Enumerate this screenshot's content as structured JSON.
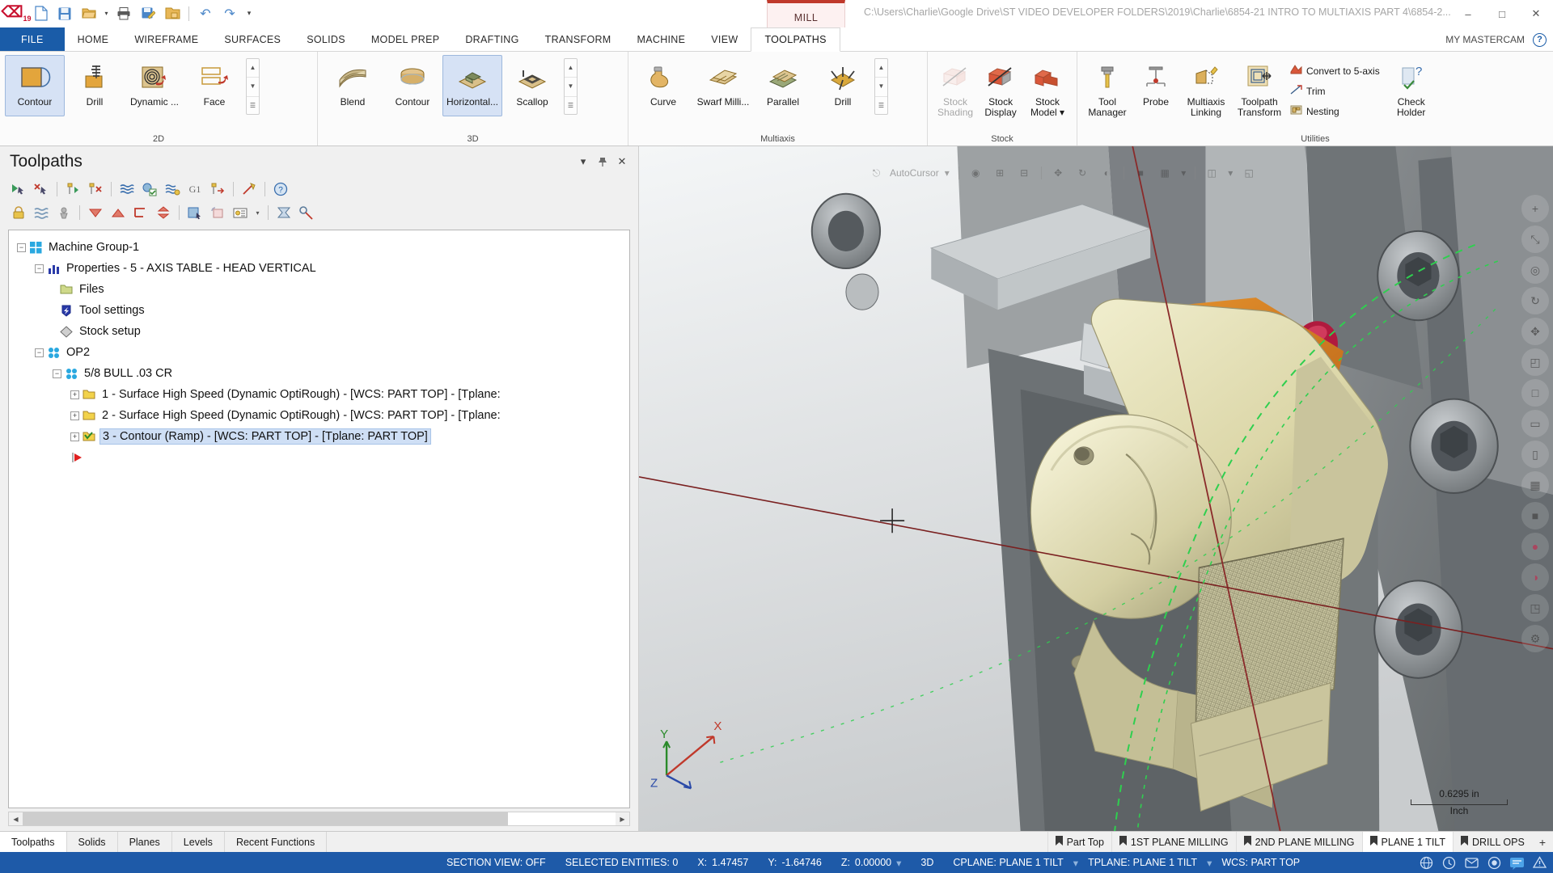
{
  "titlebar": {
    "logo": "mastercam-logo",
    "quick_access": [
      {
        "name": "new-file",
        "glyph": "🗋"
      },
      {
        "name": "save-file",
        "glyph": "💾"
      },
      {
        "name": "open-file",
        "glyph": "📂"
      },
      {
        "name": "print",
        "glyph": "🖨"
      },
      {
        "name": "save-as",
        "glyph": "📝"
      },
      {
        "name": "open-folder",
        "glyph": "📁"
      },
      {
        "name": "undo",
        "glyph": "↶"
      },
      {
        "name": "redo",
        "glyph": "↷"
      },
      {
        "name": "customize-qat",
        "glyph": "▾"
      }
    ],
    "machine_tab": "MILL",
    "file_path": "C:\\Users\\Charlie\\Google Drive\\ST VIDEO DEVELOPER FOLDERS\\2019\\Charlie\\6854-21 INTRO TO MULTIAXIS PART 4\\6854-2...",
    "window_controls": [
      {
        "name": "minimize-button",
        "glyph": "–"
      },
      {
        "name": "maximize-button",
        "glyph": "□"
      },
      {
        "name": "close-button",
        "glyph": "✕"
      }
    ]
  },
  "ribbon": {
    "tabs": [
      {
        "label": "FILE",
        "state": "file"
      },
      {
        "label": "HOME",
        "state": ""
      },
      {
        "label": "WIREFRAME",
        "state": ""
      },
      {
        "label": "SURFACES",
        "state": ""
      },
      {
        "label": "SOLIDS",
        "state": ""
      },
      {
        "label": "MODEL PREP",
        "state": ""
      },
      {
        "label": "DRAFTING",
        "state": ""
      },
      {
        "label": "TRANSFORM",
        "state": ""
      },
      {
        "label": "MACHINE",
        "state": ""
      },
      {
        "label": "VIEW",
        "state": ""
      },
      {
        "label": "TOOLPATHS",
        "state": "active"
      }
    ],
    "account_label": "MY MASTERCAM",
    "help_label": "?",
    "groups": [
      {
        "name": "2d",
        "label": "2D",
        "buttons": [
          {
            "label": "Contour",
            "icon": "contour-2d-icon",
            "state": "sel"
          },
          {
            "label": "Drill",
            "icon": "drill-2d-icon",
            "state": ""
          },
          {
            "label": "Dynamic ...",
            "icon": "dynamic-mill-icon",
            "state": ""
          },
          {
            "label": "Face",
            "icon": "face-icon",
            "state": ""
          }
        ],
        "has_gallery_nav": true
      },
      {
        "name": "3d",
        "label": "3D",
        "buttons": [
          {
            "label": "Blend",
            "icon": "blend-icon",
            "state": ""
          },
          {
            "label": "Contour",
            "icon": "contour-3d-icon",
            "state": ""
          },
          {
            "label": "Horizontal...",
            "icon": "horizontal-area-icon",
            "state": "sel"
          },
          {
            "label": "Scallop",
            "icon": "scallop-icon",
            "state": ""
          }
        ],
        "has_gallery_nav": true
      },
      {
        "name": "multiaxis",
        "label": "Multiaxis",
        "buttons": [
          {
            "label": "Curve",
            "icon": "curve-icon",
            "state": ""
          },
          {
            "label": "Swarf Milli...",
            "icon": "swarf-milling-icon",
            "state": ""
          },
          {
            "label": "Parallel",
            "icon": "parallel-icon",
            "state": ""
          },
          {
            "label": "Drill",
            "icon": "multiaxis-drill-icon",
            "state": ""
          }
        ],
        "has_gallery_nav": true
      },
      {
        "name": "stock",
        "label": "Stock",
        "buttons": [
          {
            "label": "Stock Shading",
            "icon": "stock-shading-icon",
            "state": "disabled"
          },
          {
            "label": "Stock Display",
            "icon": "stock-display-icon",
            "state": ""
          },
          {
            "label": "Stock Model ▾",
            "icon": "stock-model-icon",
            "state": ""
          }
        ],
        "has_gallery_nav": false
      },
      {
        "name": "utilities",
        "label": "Utilities",
        "buttons": [
          {
            "label": "Tool Manager",
            "icon": "tool-manager-icon",
            "state": ""
          },
          {
            "label": "Probe",
            "icon": "probe-icon",
            "state": ""
          },
          {
            "label": "Multiaxis Linking",
            "icon": "multiaxis-linking-icon",
            "state": ""
          },
          {
            "label": "Toolpath Transform",
            "icon": "toolpath-transform-icon",
            "state": ""
          }
        ],
        "small_buttons": [
          {
            "label": "Convert to 5-axis",
            "icon": "convert-5axis-icon"
          },
          {
            "label": "Trim",
            "icon": "trim-icon"
          },
          {
            "label": "Nesting",
            "icon": "nesting-icon"
          }
        ],
        "tall_buttons": [
          {
            "label": "Check Holder",
            "icon": "check-holder-icon"
          }
        ],
        "has_gallery_nav": false
      }
    ]
  },
  "toolpaths_panel": {
    "title": "Toolpaths",
    "header_buttons": [
      {
        "name": "panel-dropdown-button",
        "glyph": "▾"
      },
      {
        "name": "panel-pin-button",
        "glyph": "📌"
      },
      {
        "name": "panel-close-button",
        "glyph": "✕"
      }
    ],
    "toolbar_row1": [
      {
        "name": "select-all-operations-icon",
        "glyph": "▶"
      },
      {
        "name": "select-all-invalid-icon",
        "glyph": "✖"
      },
      {
        "name": "regenerate-all-selected-icon",
        "glyph": "↑"
      },
      {
        "name": "regenerate-all-dirty-icon",
        "glyph": "✗"
      },
      {
        "name": "simulate-toolpath-icon",
        "glyph": "≋"
      },
      {
        "name": "verify-toolpath-icon",
        "glyph": "◑"
      },
      {
        "name": "simulate-selected-icon",
        "glyph": "≈"
      },
      {
        "name": "g1-post-icon",
        "glyph": "G1"
      },
      {
        "name": "high-speed-icon",
        "glyph": "↦"
      },
      {
        "name": "edit-toolpath-icon",
        "glyph": "✇"
      },
      {
        "name": "help-icon",
        "glyph": "?"
      }
    ],
    "toolbar_row2": [
      {
        "name": "lock-selected-icon",
        "glyph": "🔒"
      },
      {
        "name": "toggle-posting-icon",
        "glyph": "≋"
      },
      {
        "name": "toggle-display-icon",
        "glyph": "☸"
      },
      {
        "name": "move-down-icon",
        "glyph": "▼"
      },
      {
        "name": "move-up-icon",
        "glyph": "▲"
      },
      {
        "name": "new-group-icon",
        "glyph": "⌐"
      },
      {
        "name": "expand-collapse-icon",
        "glyph": "⇅"
      },
      {
        "name": "toolpath-display-icon",
        "glyph": "◰"
      },
      {
        "name": "toolpath-lock-icon",
        "glyph": "▧"
      },
      {
        "name": "toolpath-options-icon",
        "glyph": "▤"
      },
      {
        "name": "toolpath-options-dropdown-icon",
        "glyph": "▾"
      },
      {
        "name": "refresh-icon",
        "glyph": "⧖"
      },
      {
        "name": "settings-icon",
        "glyph": "⚙"
      }
    ],
    "tree": [
      {
        "depth": 0,
        "expander": "−",
        "icon": "machine-group-icon",
        "label": "Machine Group-1",
        "selected": false
      },
      {
        "depth": 1,
        "expander": "−",
        "icon": "properties-icon",
        "label": "Properties - 5 - AXIS TABLE - HEAD VERTICAL",
        "selected": false
      },
      {
        "depth": 2,
        "expander": "",
        "icon": "files-folder-icon",
        "label": "Files",
        "selected": false
      },
      {
        "depth": 2,
        "expander": "",
        "icon": "tool-settings-icon",
        "label": "Tool settings",
        "selected": false
      },
      {
        "depth": 2,
        "expander": "",
        "icon": "stock-setup-icon",
        "label": "Stock setup",
        "selected": false
      },
      {
        "depth": 0,
        "expander": "−",
        "icon": "toolpath-group-icon",
        "label": "OP2",
        "selected": false
      },
      {
        "depth": 1,
        "expander": "−",
        "icon": "toolpath-group-icon",
        "label": "5/8 BULL .03 CR",
        "selected": false
      },
      {
        "depth": 2,
        "expander": "+",
        "icon": "folder-yellow-icon",
        "label": "1 - Surface High Speed (Dynamic OptiRough) - [WCS: PART TOP] - [Tplane:",
        "selected": false
      },
      {
        "depth": 2,
        "expander": "+",
        "icon": "folder-yellow-icon",
        "label": "2 - Surface High Speed (Dynamic OptiRough) - [WCS: PART TOP] - [Tplane:",
        "selected": false
      },
      {
        "depth": 2,
        "expander": "+",
        "icon": "folder-check-icon",
        "label": "3 - Contour (Ramp) - [WCS: PART TOP] - [Tplane: PART TOP]",
        "selected": true
      },
      {
        "depth": 2,
        "expander": "",
        "icon": "insert-arrow-icon",
        "label": "",
        "selected": false
      }
    ],
    "scrollbar": {
      "left_arrow": "◀",
      "right_arrow": "▶"
    }
  },
  "viewport": {
    "autocursor_label": "AutoCursor",
    "float_toolbar": [
      {
        "name": "autocursor-icon",
        "glyph": "⌖"
      },
      {
        "name": "autocursor-dropdown-icon",
        "glyph": "▾"
      },
      {
        "name": "fit-view-icon",
        "glyph": "⊙"
      },
      {
        "name": "zoom-window-icon",
        "glyph": "⊞"
      },
      {
        "name": "unzoom-icon",
        "glyph": "⊟"
      },
      {
        "name": "pan-icon",
        "glyph": "✥"
      },
      {
        "name": "rotate-icon",
        "glyph": "↻"
      },
      {
        "name": "wireframe-shading-icon",
        "glyph": "◐"
      },
      {
        "name": "shaded-icon",
        "glyph": "■"
      },
      {
        "name": "grid-icon",
        "glyph": "▦"
      },
      {
        "name": "grid-dropdown-icon",
        "glyph": "▾"
      },
      {
        "name": "view-level-icon",
        "glyph": "◫"
      },
      {
        "name": "view-dropdown-icon",
        "glyph": "▾"
      },
      {
        "name": "section-view-icon",
        "glyph": "◱"
      }
    ],
    "right_rail": [
      {
        "name": "zoom-in-icon",
        "glyph": "+"
      },
      {
        "name": "fit-screen-icon",
        "glyph": "⤡"
      },
      {
        "name": "zoom-target-icon",
        "glyph": "◎"
      },
      {
        "name": "dynamic-rotate-icon",
        "glyph": "↻"
      },
      {
        "name": "pan-view-icon",
        "glyph": "✥"
      },
      {
        "name": "isometric-view-icon",
        "glyph": "◰"
      },
      {
        "name": "top-view-icon",
        "glyph": "□"
      },
      {
        "name": "front-view-icon",
        "glyph": "▭"
      },
      {
        "name": "right-view-icon",
        "glyph": "▯"
      },
      {
        "name": "wireframe-icon",
        "glyph": "▦"
      },
      {
        "name": "shaded-view-icon",
        "glyph": "■"
      },
      {
        "name": "material-view-icon",
        "glyph": "●"
      },
      {
        "name": "transparency-icon",
        "glyph": "◑"
      },
      {
        "name": "clipping-icon",
        "glyph": "◳"
      },
      {
        "name": "view-settings-icon",
        "glyph": "⚙"
      }
    ],
    "scale_value": "0.6295 in",
    "scale_unit": "Inch",
    "gnomon": {
      "x": "X",
      "y": "Y",
      "z": "Z"
    }
  },
  "bottom_tabs": {
    "left": [
      {
        "label": "Toolpaths",
        "active": true
      },
      {
        "label": "Solids",
        "active": false
      },
      {
        "label": "Planes",
        "active": false
      },
      {
        "label": "Levels",
        "active": false
      },
      {
        "label": "Recent Functions",
        "active": false
      }
    ],
    "views": [
      {
        "label": "Part Top",
        "active": false
      },
      {
        "label": "1ST PLANE MILLING",
        "active": false
      },
      {
        "label": "2ND PLANE MILLING",
        "active": false
      },
      {
        "label": "PLANE 1 TILT",
        "active": true
      },
      {
        "label": "DRILL OPS",
        "active": false
      }
    ],
    "add_view": "+"
  },
  "statusbar": {
    "section_view": "SECTION VIEW: OFF",
    "selected_entities": "SELECTED ENTITIES: 0",
    "x_label": "X:",
    "x_value": "1.47457",
    "y_label": "Y:",
    "y_value": "-1.64746",
    "z_label": "Z:",
    "z_value": "0.00000",
    "dim_mode": "3D",
    "cplane": "CPLANE: PLANE 1 TILT",
    "tplane": "TPLANE: PLANE 1 TILT",
    "wcs": "WCS: PART TOP",
    "right_icons": [
      {
        "name": "globe-icon",
        "glyph": "🌐",
        "accent": false
      },
      {
        "name": "clock-icon",
        "glyph": "◴",
        "accent": false
      },
      {
        "name": "message-icon",
        "glyph": "✉",
        "accent": false
      },
      {
        "name": "record-icon",
        "glyph": "◉",
        "accent": false
      },
      {
        "name": "chat-icon",
        "glyph": "▣",
        "accent": true
      },
      {
        "name": "alert-icon",
        "glyph": "▲",
        "accent": false
      }
    ]
  },
  "colors": {
    "accent_blue": "#1e5aa8",
    "file_tab_blue": "#1a5ca8",
    "mill_red": "#c0392b",
    "selection_blue": "#cfdff5",
    "part_gold": "#d9d6ac",
    "orange_face": "#e08b2a"
  }
}
